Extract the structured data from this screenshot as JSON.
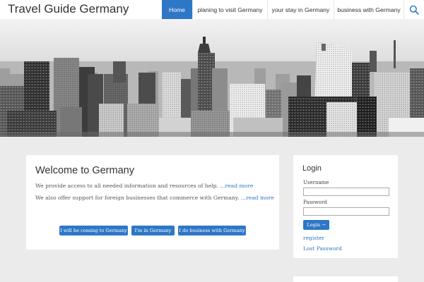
{
  "header": {
    "site_title": "Travel Guide Germany",
    "nav": {
      "home": "Home",
      "visit": "planing to visit Germany",
      "stay": "your stay in Germany",
      "business": "business with Germany",
      "search_icon": "search-icon"
    },
    "accent_color": "#2e77c6"
  },
  "hero": {
    "image": "black-and-white city skyline photo"
  },
  "welcome": {
    "title": "Welcome to Germany",
    "para1": "We provide access to all needed information and resources of help. ",
    "para1_link": "...read more",
    "para2": "We also offer support for foreign businesses that commerce with Germany. ",
    "para2_link": "...read more",
    "buttons": {
      "coming": "I will be coming to Germany",
      "in": "I'm in Germany",
      "business": "I do business with Germany"
    }
  },
  "login": {
    "title": "Login",
    "username_label": "Username",
    "username_value": "",
    "password_label": "Password",
    "password_value": "",
    "login_button": "Login →",
    "register_link": "register",
    "lost_password_link": "Lost Password"
  }
}
